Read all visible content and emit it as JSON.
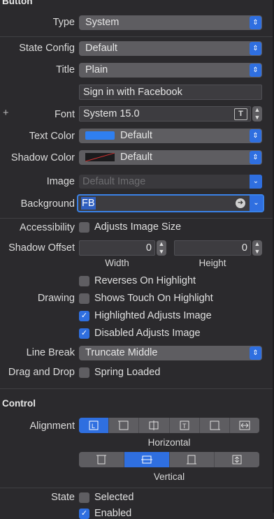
{
  "button_section": {
    "title": "Button",
    "type": {
      "label": "Type",
      "value": "System"
    },
    "state_config": {
      "label": "State Config",
      "value": "Default"
    },
    "title_field": {
      "label": "Title",
      "value": "Plain"
    },
    "title_text": "Sign in with Facebook",
    "font": {
      "label": "Font",
      "value": "System 15.0",
      "add_glyph": "+",
      "font_icon_glyph": "T"
    },
    "text_color": {
      "label": "Text Color",
      "value": "Default",
      "swatch_color": "#2f7ff0"
    },
    "shadow_color": {
      "label": "Shadow Color",
      "value": "Default"
    },
    "image": {
      "label": "Image",
      "placeholder": "Default Image"
    },
    "background": {
      "label": "Background",
      "value": "FB"
    },
    "accessibility": {
      "label": "Accessibility",
      "checkbox": "Adjusts Image Size",
      "checked": false
    },
    "shadow_offset": {
      "label": "Shadow Offset",
      "width_value": "0",
      "height_value": "0",
      "width_caption": "Width",
      "height_caption": "Height"
    },
    "drawing": {
      "label": "Drawing",
      "options": [
        {
          "text": "Reverses On Highlight",
          "checked": false
        },
        {
          "text": "Shows Touch On Highlight",
          "checked": false
        },
        {
          "text": "Highlighted Adjusts Image",
          "checked": true
        },
        {
          "text": "Disabled Adjusts Image",
          "checked": true
        }
      ]
    },
    "line_break": {
      "label": "Line Break",
      "value": "Truncate Middle"
    },
    "drag_drop": {
      "label": "Drag and Drop",
      "checkbox": "Spring Loaded",
      "checked": false
    }
  },
  "control_section": {
    "title": "Control",
    "alignment": {
      "label": "Alignment",
      "horizontal_caption": "Horizontal",
      "vertical_caption": "Vertical",
      "horizontal_icons": [
        "align-left-icon",
        "align-center-icon",
        "align-center-split-icon",
        "align-top-icon",
        "align-right-icon",
        "align-fill-icon"
      ],
      "vertical_icons": [
        "align-top-v-icon",
        "align-center-v-icon",
        "align-bottom-v-icon",
        "align-fill-v-icon"
      ],
      "horizontal_selected": 0,
      "vertical_selected": 1
    },
    "state": {
      "label": "State",
      "options": [
        {
          "text": "Selected",
          "checked": false
        },
        {
          "text": "Enabled",
          "checked": true
        }
      ]
    }
  },
  "colors": {
    "accent": "#2f6fe0",
    "background": "#2b2a2d",
    "popup": "#5e5d61"
  }
}
